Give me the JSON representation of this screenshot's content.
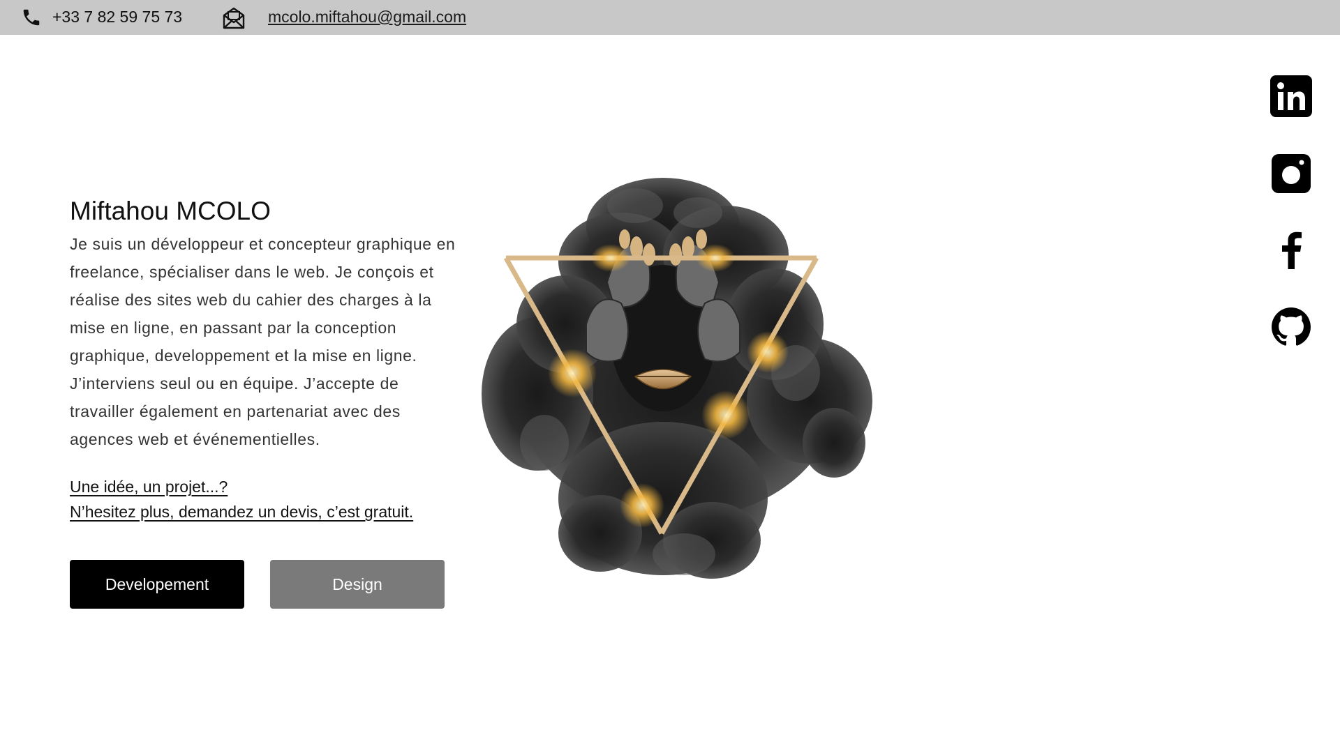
{
  "contact": {
    "phone": "+33 7 82 59 75 73",
    "email": "mcolo.miftahou@gmail.com",
    "phone_icon": "phone-icon",
    "email_icon": "mail-icon"
  },
  "intro": {
    "name": "Miftahou MCOLO",
    "bio": "Je suis un développeur et concepteur graphique en freelance, spécialiser dans le web. Je conçois et réalise des sites web du cahier des charges à la mise en ligne, en passant par la conception graphique, developpement et la mise en ligne. J’interviens seul ou en équipe. J’accepte de travailler également en partenariat avec des agences web et événementielles.",
    "cta_line1": "Une idée, un projet...?",
    "cta_line2": "N’hesitez plus, demandez un devis, c’est gratuit."
  },
  "buttons": {
    "development": "Developement",
    "design": "Design"
  },
  "social": [
    "linkedin-icon",
    "instagram-icon",
    "facebook-icon",
    "github-icon"
  ],
  "colors": {
    "topbar": "#c8c8c8",
    "primary_button": "#000000",
    "secondary_button": "#7a7a7a",
    "gold": "#d9b98a"
  }
}
